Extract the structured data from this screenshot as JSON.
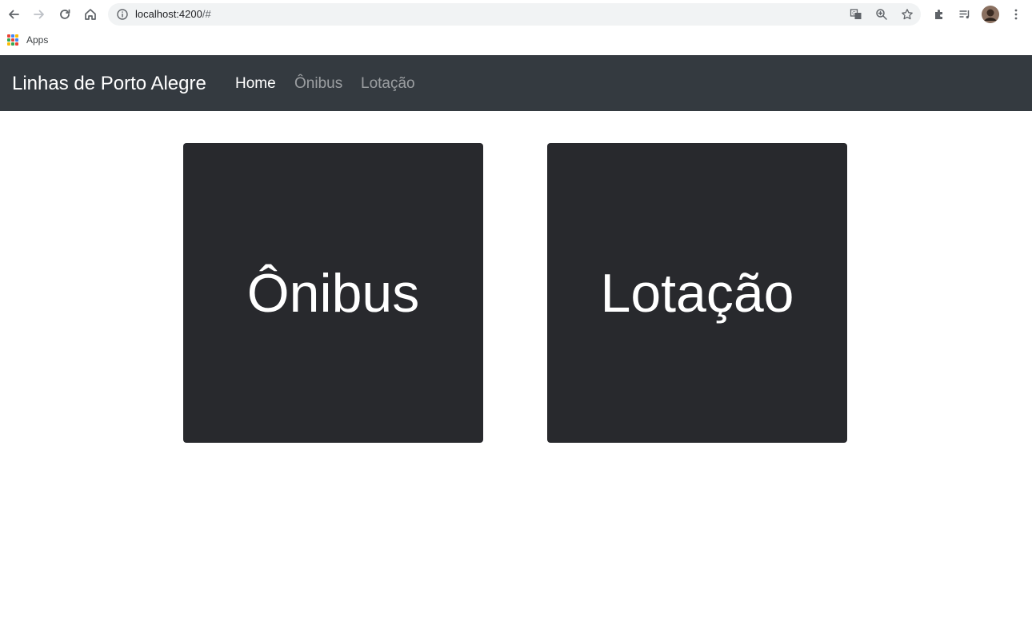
{
  "browser": {
    "url_host": "localhost:4200",
    "url_path": "/#",
    "bookmarks": {
      "apps_label": "Apps"
    }
  },
  "navbar": {
    "brand": "Linhas de Porto Alegre",
    "links": [
      {
        "label": "Home",
        "active": true
      },
      {
        "label": "Ônibus",
        "active": false
      },
      {
        "label": "Lotação",
        "active": false
      }
    ]
  },
  "cards": [
    {
      "title": "Ônibus"
    },
    {
      "title": "Lotação"
    }
  ],
  "colors": {
    "navbar_bg": "#343a40",
    "card_bg": "#28292d",
    "active_link": "#ffffff",
    "muted_link": "rgba(255,255,255,0.5)"
  }
}
